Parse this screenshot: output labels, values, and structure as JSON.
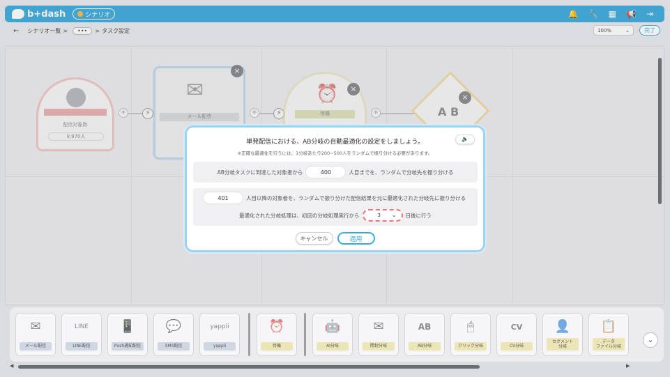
{
  "app": {
    "logo_text": "b+dash",
    "scenario_pill": "シナリオ"
  },
  "topbar_icons": [
    "bell-icon",
    "wrench-icon",
    "grid-icon",
    "megaphone-icon",
    "logout-icon"
  ],
  "breadcrumb": {
    "back": "←",
    "item1": "シナリオ一覧",
    "sep": ">",
    "more": "•••",
    "current": "タスク設定"
  },
  "zoom": {
    "value": "100%",
    "chevron": "⌄"
  },
  "done_label": "完了",
  "canvas": {
    "target_node": {
      "label": "配信対象数",
      "count": "9,870人"
    },
    "mail_node": {
      "label": "メール配信"
    },
    "wait_node": {
      "label": "待機"
    },
    "ab_node": {
      "label": "A B"
    },
    "plus": "+",
    "bolt": "⚡",
    "close": "×"
  },
  "modal": {
    "title": "単発配信における、AB分岐の自動最適化の設定をしましょう。",
    "note": "※正確な最適化を行うには、1分岐あたり200~500人をランダムで振り分ける必要があります。",
    "help_icon": "🔈",
    "row1": {
      "prefix": "AB分岐タスクに到達した対象者から",
      "value": "400",
      "suffix": "人目までを、ランダムで分岐先を振り分ける"
    },
    "row2": {
      "value": "401",
      "text": "人目以降の対象者を、ランダムで振り分けた配信結果を元に最適化された分岐先に振り分ける"
    },
    "row3": {
      "prefix": "最適化された分岐処理は、初回の分岐処理実行から",
      "value": "3",
      "chevron": "⌄",
      "suffix": "日後に行う"
    },
    "cancel_label": "キャンセル",
    "apply_label": "適用"
  },
  "palette": {
    "items": [
      {
        "label": "メール配信",
        "icon": "✉",
        "color": "blue"
      },
      {
        "label": "LINE配信",
        "icon": "LINE",
        "color": "blue"
      },
      {
        "label": "Push通知配信",
        "icon": "📱",
        "color": "blue"
      },
      {
        "label": "SMS配信",
        "icon": "💬",
        "color": "blue"
      },
      {
        "label": "yappli",
        "icon": "yappli",
        "color": "blue"
      },
      {
        "label": "待機",
        "icon": "⏰",
        "color": "yellow"
      },
      {
        "label": "AI分岐",
        "icon": "🤖",
        "color": "yellow"
      },
      {
        "label": "開封分岐",
        "icon": "✉",
        "color": "yellow"
      },
      {
        "label": "AB分岐",
        "icon": "AB",
        "color": "yellow"
      },
      {
        "label": "クリック分岐",
        "icon": "🖱",
        "color": "yellow"
      },
      {
        "label": "CV分岐",
        "icon": "CV",
        "color": "yellow"
      },
      {
        "label": "セグメント\n分岐",
        "icon": "👤",
        "color": "yellow"
      },
      {
        "label": "データ\nファイル分岐",
        "icon": "📋",
        "color": "yellow"
      }
    ],
    "toggle": "⌄"
  },
  "hscroll": {
    "left": "◀",
    "right": "▶"
  }
}
